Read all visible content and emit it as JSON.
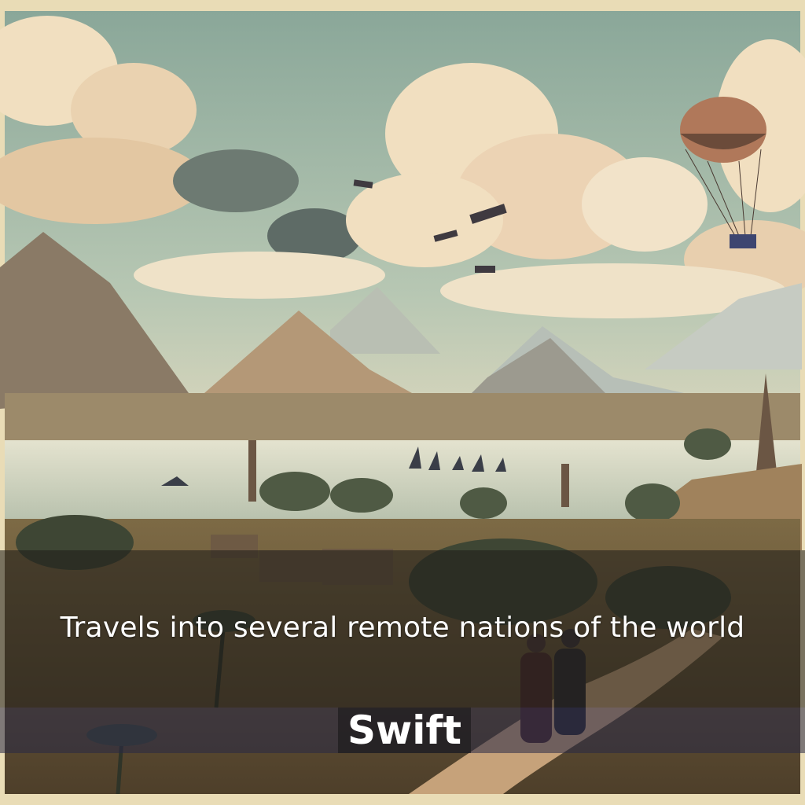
{
  "book": {
    "title": "Travels into several remote nations of the world",
    "author": "Swift"
  },
  "palette": {
    "sky": "#9bb3a0",
    "cloud": "#f1dfc0",
    "mountain": "#9a7a5c",
    "lake": "#d9dcc6",
    "foreground": "#6b5a3c",
    "band": "#1e1c18"
  },
  "icons": [
    "hot-air-balloon-icon",
    "biplane-icon",
    "sailboat-icon",
    "palm-tree-icon",
    "travelers-icon"
  ]
}
